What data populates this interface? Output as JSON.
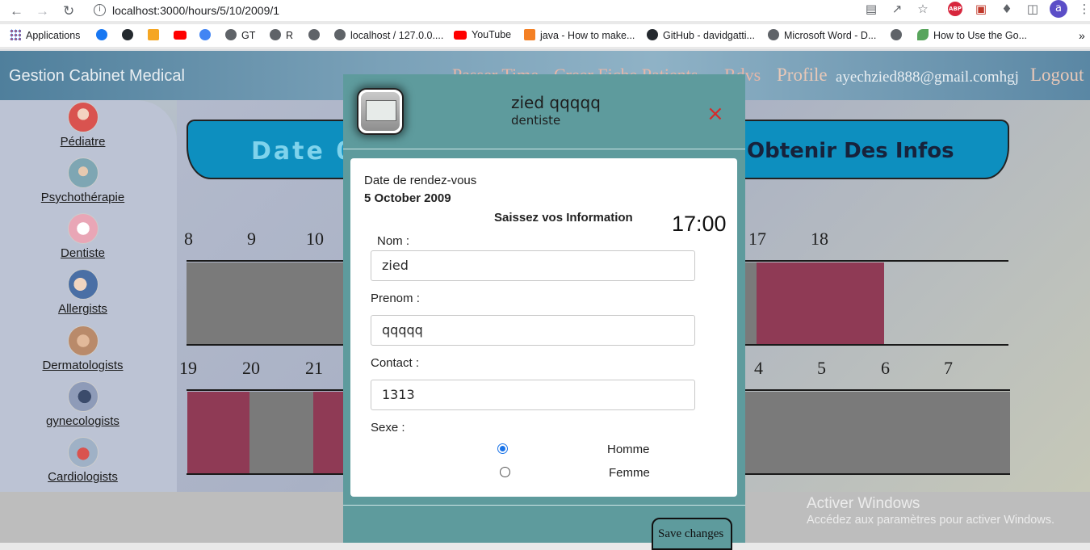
{
  "browser": {
    "url": "localhost:3000/hours/5/10/2009/1",
    "bookmarks": [
      {
        "label": "Applications",
        "color": "#ea4335"
      },
      {
        "label": "",
        "color": "#1877f2"
      },
      {
        "label": "",
        "color": "#24292e"
      },
      {
        "label": "",
        "color": "#f5a623"
      },
      {
        "label": "",
        "color": "#ff0000"
      },
      {
        "label": "",
        "color": "#4285f4"
      },
      {
        "label": "GT",
        "color": "#5f6368"
      },
      {
        "label": "R",
        "color": "#5f6368"
      },
      {
        "label": "",
        "color": "#5f6368"
      },
      {
        "label": "localhost / 127.0.0....",
        "color": "#5f6368"
      },
      {
        "label": "YouTube",
        "color": "#ff0000"
      },
      {
        "label": "java - How to make...",
        "color": "#f48024"
      },
      {
        "label": "GitHub - davidgatti...",
        "color": "#24292e"
      },
      {
        "label": "Microsoft Word - D...",
        "color": "#5f6368"
      },
      {
        "label": "",
        "color": "#5f6368"
      },
      {
        "label": "How to Use the Go...",
        "color": "#58a55c"
      }
    ],
    "more": "»"
  },
  "header": {
    "brand": "Gestion Cabinet Medical",
    "nav": [
      "Passer Time",
      "Creer Fiche Patients",
      "Rdvs"
    ],
    "profile": "Profile",
    "email": "ayechzied888@gmail.comhgj",
    "logout": "Logout"
  },
  "sidebar": {
    "items": [
      {
        "label": "Pédiatre",
        "color": "#d9534f"
      },
      {
        "label": "Psychothérapie",
        "color": "#7ea6b3"
      },
      {
        "label": "Dentiste",
        "color": "#e9a6b6"
      },
      {
        "label": "Allergists",
        "color": "#c9a48a"
      },
      {
        "label": "Dermatologists",
        "color": "#b98a6a"
      },
      {
        "label": "gynecologists",
        "color": "#5b6a8a"
      },
      {
        "label": "Cardiologists",
        "color": "#d9534f"
      }
    ]
  },
  "banner": {
    "date_text": "Date 05",
    "info_button": "Obtenir Des Infos"
  },
  "schedule": {
    "row1_hours": [
      "8",
      "9",
      "10",
      "17",
      "18"
    ],
    "row2_hours": [
      "19",
      "20",
      "21",
      "4",
      "5",
      "6",
      "7"
    ]
  },
  "modal": {
    "doctor_name": "zied qqqqq",
    "specialty": "dentiste",
    "close": "×",
    "date_label": "Date de rendez-vous",
    "date_value": "5 October 2009",
    "section_title": "Saissez vos Information",
    "time": "17:00",
    "fields": {
      "nom_label": "Nom :",
      "nom_value": "zied",
      "prenom_label": "Prenom :",
      "prenom_value": "qqqqq",
      "contact_label": "Contact :",
      "contact_value": "1313",
      "sexe_label": "Sexe :",
      "sexe_options": [
        "Homme",
        "Femme"
      ],
      "sexe_selected": "Homme"
    },
    "save_button": "Save changes"
  },
  "watermark": {
    "title": "Activer Windows",
    "subtitle": "Accédez aux paramètres pour activer Windows."
  }
}
